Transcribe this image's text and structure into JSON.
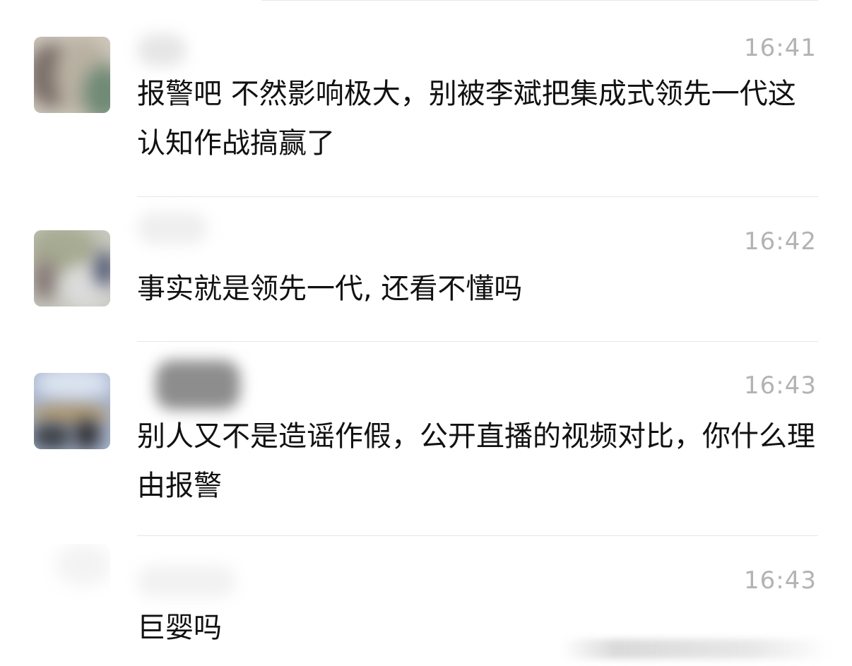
{
  "comments": [
    {
      "time": "16:41",
      "text": "报警吧 不然影响极大，别被李斌把集成式领先一代这认知作战搞赢了"
    },
    {
      "time": "16:42",
      "text": "事实就是领先一代, 还看不懂吗"
    },
    {
      "time": "16:43",
      "text": "别人又不是造谣作假，公开直播的视频对比，你什么理由报警"
    },
    {
      "time": "16:43",
      "text": "巨婴吗"
    }
  ]
}
